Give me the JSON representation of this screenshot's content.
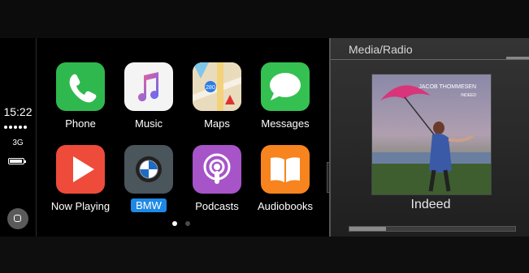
{
  "status": {
    "time": "15:22",
    "network": "3G",
    "signal_icon": "signal-dots-icon",
    "battery_icon": "battery-icon",
    "home_icon": "home-button-icon"
  },
  "apps": [
    {
      "label": "Phone",
      "icon": "phone-icon",
      "color": "#2fb84e"
    },
    {
      "label": "Music",
      "icon": "music-note-icon",
      "color": "#f4f4f4"
    },
    {
      "label": "Maps",
      "icon": "maps-icon",
      "color": "#e8dcc0"
    },
    {
      "label": "Messages",
      "icon": "speech-bubble-icon",
      "color": "#35c052"
    },
    {
      "label": "Now Playing",
      "icon": "play-icon",
      "color": "#ee4b3a"
    },
    {
      "label": "BMW",
      "icon": "bmw-logo-icon",
      "color": "#4a555c"
    },
    {
      "label": "Podcasts",
      "icon": "podcasts-icon",
      "color": "#a654c8"
    },
    {
      "label": "Audiobooks",
      "icon": "book-icon",
      "color": "#f7841e"
    }
  ],
  "pager": {
    "current": 1,
    "total": 2
  },
  "media": {
    "title": "Media/Radio",
    "album_artist": "JACOB THOMMESEN",
    "album_title": "INDEED",
    "track": "Indeed",
    "progress": 0.22
  },
  "colors": {
    "accent": "#1e88e5",
    "background": "#000000"
  }
}
